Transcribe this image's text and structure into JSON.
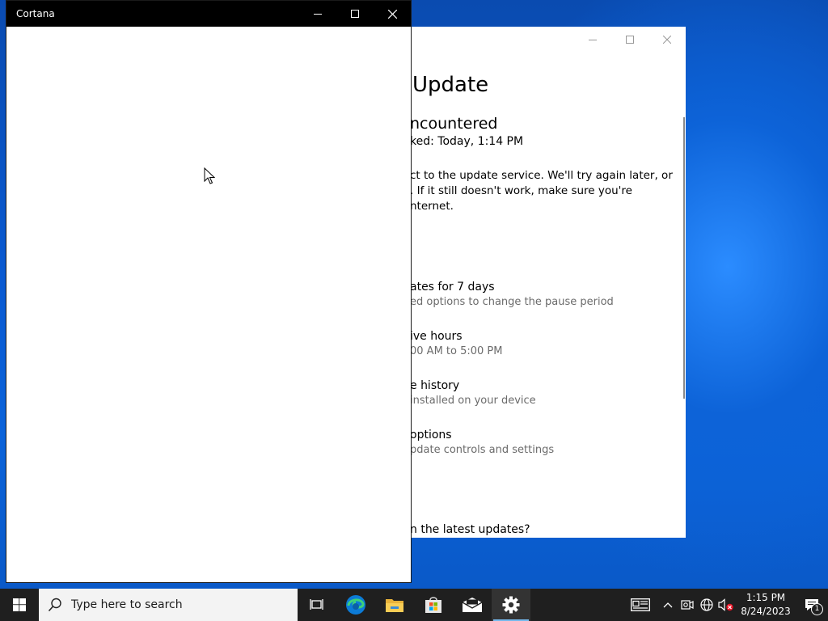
{
  "settings": {
    "page_title": "Update",
    "status_title": "ncountered",
    "last_checked": "ked: Today, 1:14 PM",
    "error_lines": [
      "ct to the update service. We'll try again later, or",
      ". If it still doesn't work, make sure you're",
      "nternet."
    ],
    "options": [
      {
        "title": "ates for 7 days",
        "sub": "ed options to change the pause period"
      },
      {
        "title": "ive hours",
        "sub": "00 AM to 5:00 PM"
      },
      {
        "title": "e history",
        "sub": " installed on your device"
      },
      {
        "title": "options",
        "sub": "pdate controls and settings"
      }
    ],
    "bottom_question": "n the latest updates?"
  },
  "cortana": {
    "title": "Cortana"
  },
  "taskbar": {
    "search_placeholder": "Type here to search",
    "time": "1:15 PM",
    "date": "8/24/2023",
    "notification_count": "1"
  }
}
